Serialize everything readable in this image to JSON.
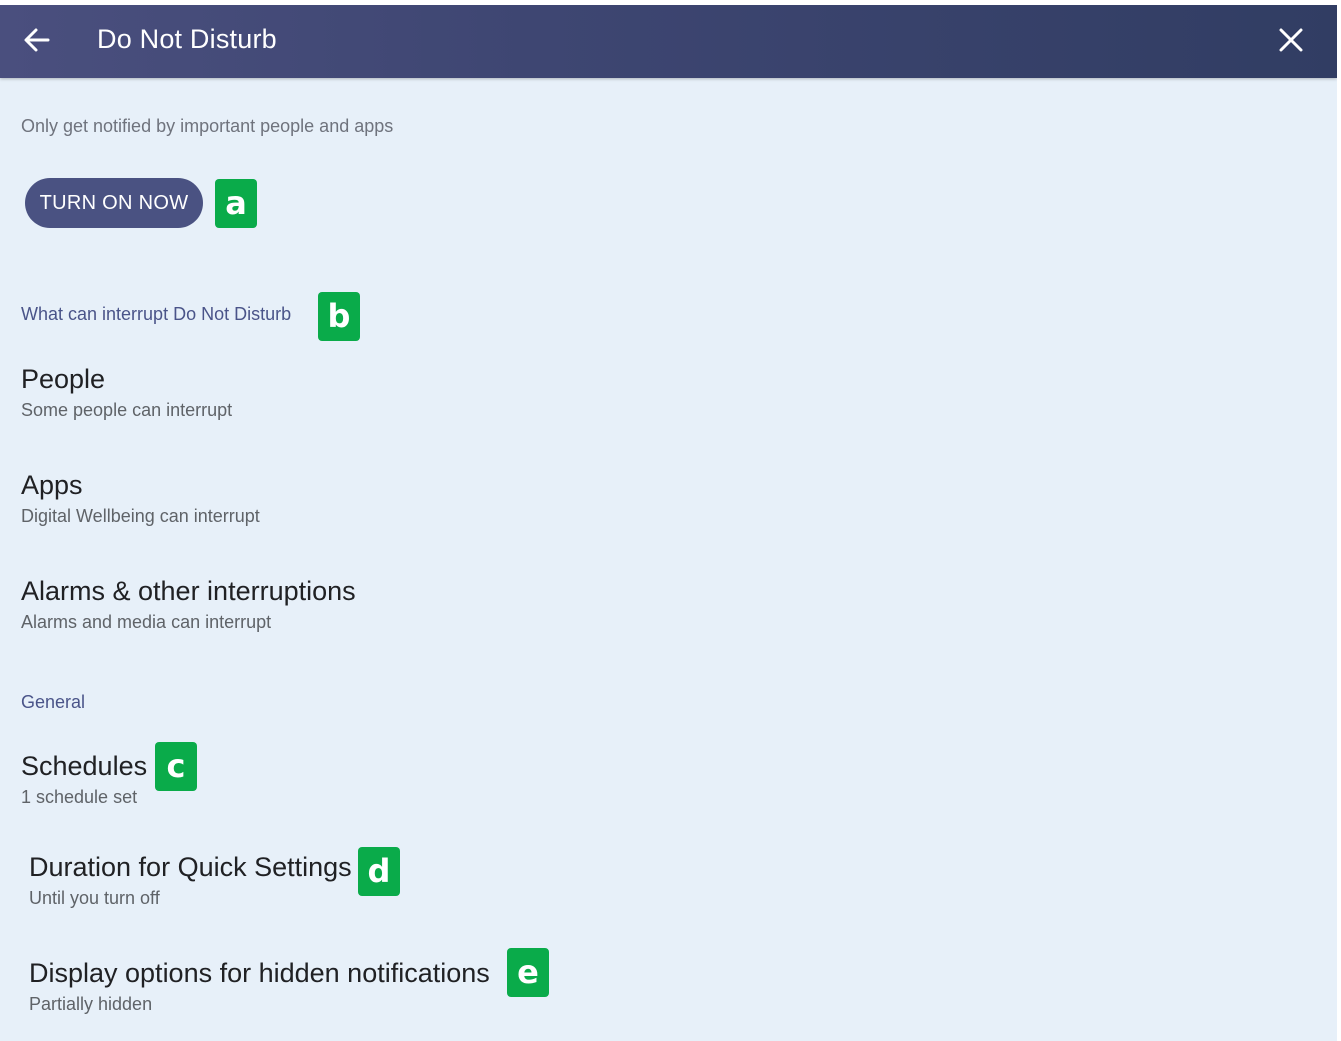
{
  "header": {
    "title": "Do Not Disturb",
    "back_icon": "arrow-left-icon",
    "close_icon": "close-icon"
  },
  "intro": {
    "subtitle": "Only get notified by important people and apps",
    "turn_on_label": "TURN ON NOW"
  },
  "sections": {
    "interrupt_header": "What can interrupt Do Not Disturb",
    "general_header": "General"
  },
  "interrupt_items": [
    {
      "title": "People",
      "subtitle": "Some people can interrupt"
    },
    {
      "title": "Apps",
      "subtitle": "Digital Wellbeing can interrupt"
    },
    {
      "title": "Alarms & other interruptions",
      "subtitle": "Alarms and media can interrupt"
    }
  ],
  "general_items": [
    {
      "title": "Schedules",
      "subtitle": "1 schedule set"
    },
    {
      "title": "Duration for Quick Settings",
      "subtitle": "Until you turn off"
    },
    {
      "title": "Display options for hidden notifications",
      "subtitle": "Partially hidden"
    }
  ],
  "badges": [
    "a",
    "b",
    "c",
    "d",
    "e"
  ],
  "colors": {
    "header": "#3e4672",
    "background": "#e7f0f9",
    "button": "#4a5282",
    "section_header": "#4a5489",
    "badge": "#0aab4a"
  }
}
